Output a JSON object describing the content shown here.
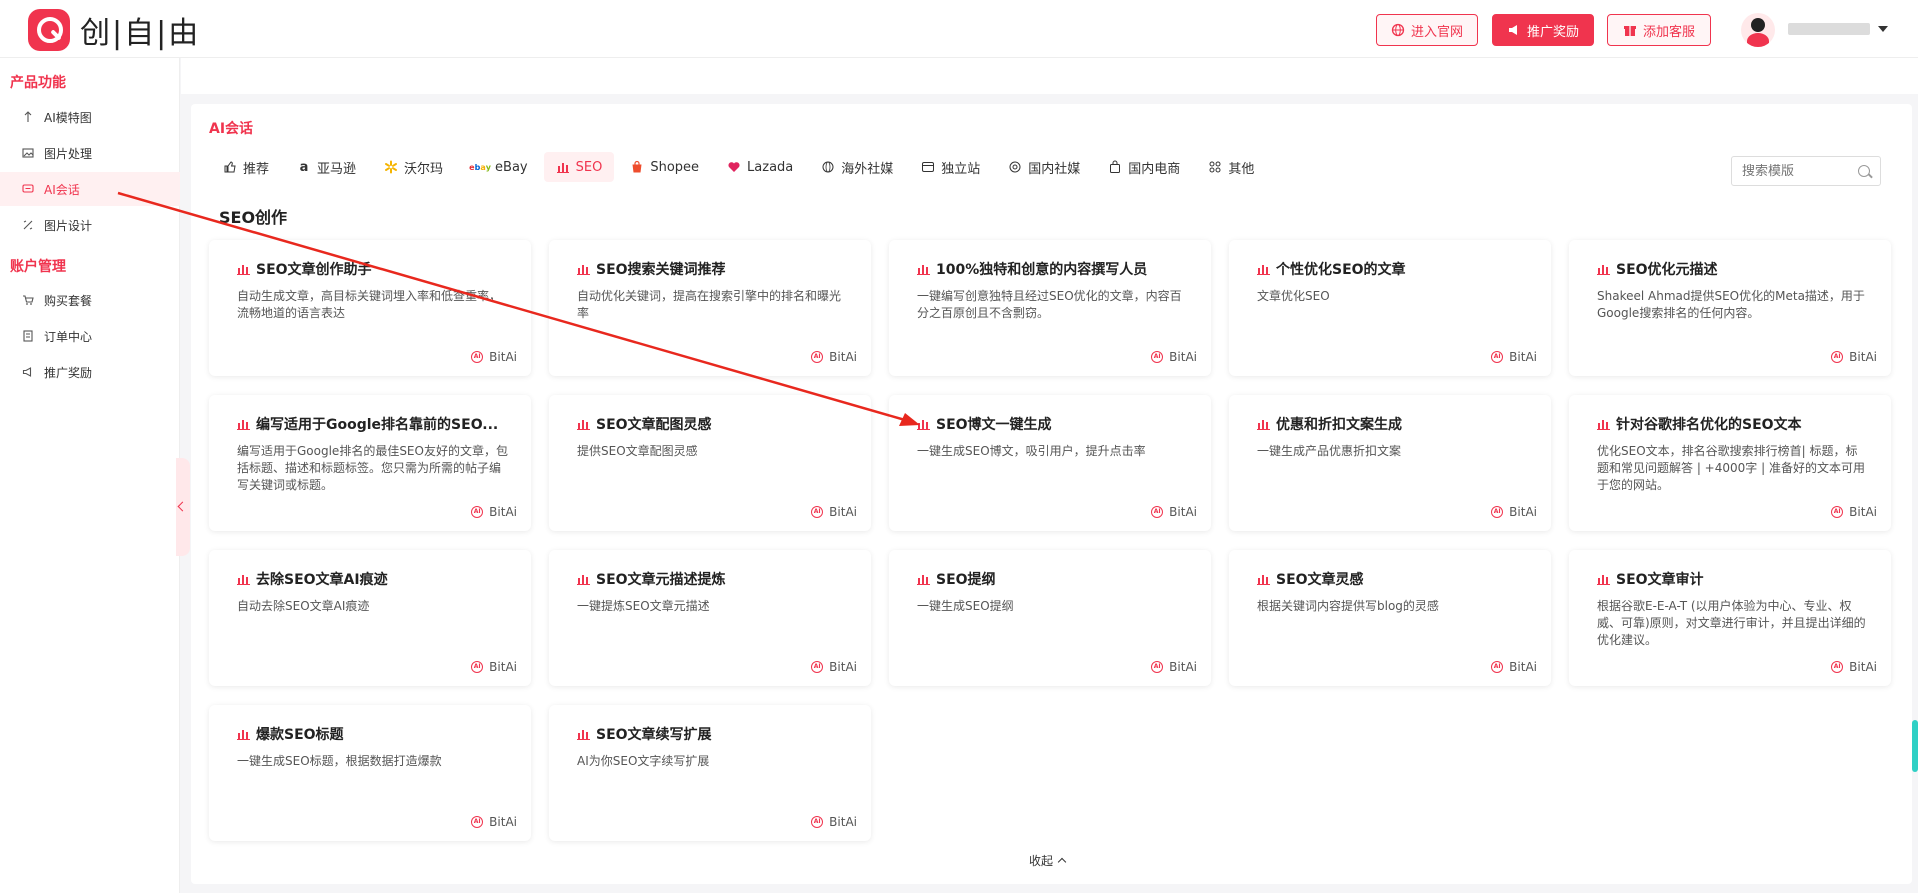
{
  "header": {
    "logo_text": "创|自|由",
    "buttons": [
      {
        "label": "进入官网",
        "icon": "globe-icon"
      },
      {
        "label": "推广奖励",
        "icon": "megaphone-icon"
      },
      {
        "label": "添加客服",
        "icon": "gift-icon"
      }
    ]
  },
  "sidebar": {
    "group1": "产品功能",
    "items1": [
      {
        "label": "AI模特图",
        "icon": "sparkle-icon"
      },
      {
        "label": "图片处理",
        "icon": "image-icon"
      },
      {
        "label": "AI会话",
        "icon": "chat-icon"
      },
      {
        "label": "图片设计",
        "icon": "palette-icon"
      }
    ],
    "group2": "账户管理",
    "items2": [
      {
        "label": "购买套餐",
        "icon": "cart-icon"
      },
      {
        "label": "订单中心",
        "icon": "order-icon"
      },
      {
        "label": "推广奖励",
        "icon": "megaphone-icon"
      }
    ]
  },
  "main": {
    "section_title": "AI会话",
    "tabs": [
      {
        "label": "推荐",
        "icon": "thumbs-up-icon"
      },
      {
        "label": "亚马逊",
        "icon": "amazon-icon"
      },
      {
        "label": "沃尔玛",
        "icon": "walmart-icon"
      },
      {
        "label": "eBay",
        "icon": "ebay-icon"
      },
      {
        "label": "SEO",
        "icon": "bar-chart-icon"
      },
      {
        "label": "Shopee",
        "icon": "shopee-icon"
      },
      {
        "label": "Lazada",
        "icon": "heart-icon"
      },
      {
        "label": "海外社媒",
        "icon": "globe-chat-icon"
      },
      {
        "label": "独立站",
        "icon": "site-icon"
      },
      {
        "label": "国内社媒",
        "icon": "circle-chat-icon"
      },
      {
        "label": "国内电商",
        "icon": "bag-icon"
      },
      {
        "label": "其他",
        "icon": "grid-icon"
      }
    ],
    "search_placeholder": "搜索模版",
    "subsection_title": "SEO创作",
    "brand": "BitAi",
    "cards": [
      {
        "title": "SEO文章创作助手",
        "desc": "自动生成文章，高目标关键词埋入率和低查重率，流畅地道的语言表达"
      },
      {
        "title": "SEO搜索关键词推荐",
        "desc": "自动优化关键词，提高在搜索引擎中的排名和曝光率"
      },
      {
        "title": "100%独特和创意的内容撰写人员",
        "desc": "一键编写创意独特且经过SEO优化的文章，内容百分之百原创且不含剽窃。"
      },
      {
        "title": "个性优化SEO的文章",
        "desc": "文章优化SEO"
      },
      {
        "title": "SEO优化元描述",
        "desc": "Shakeel Ahmad提供SEO优化的Meta描述，用于Google搜索排名的任何内容。"
      },
      {
        "title": "编写适用于Google排名靠前的SEO...",
        "desc": "编写适用于Google排名的最佳SEO友好的文章，包括标题、描述和标题标签。您只需为所需的帖子编写关键词或标题。"
      },
      {
        "title": "SEO文章配图灵感",
        "desc": "提供SEO文章配图灵感"
      },
      {
        "title": "SEO博文一键生成",
        "desc": "一键生成SEO博文，吸引用户，提升点击率"
      },
      {
        "title": "优惠和折扣文案生成",
        "desc": "一键生成产品优惠折扣文案"
      },
      {
        "title": "针对谷歌排名优化的SEO文本",
        "desc": "优化SEO文本，排名谷歌搜索排行榜首| 标题，标题和常见问题解答 | +4000字 | 准备好的文本可用于您的网站。"
      },
      {
        "title": "去除SEO文章AI痕迹",
        "desc": "自动去除SEO文章AI痕迹"
      },
      {
        "title": "SEO文章元描述提炼",
        "desc": "一键提炼SEO文章元描述"
      },
      {
        "title": "SEO提纲",
        "desc": "一键生成SEO提纲"
      },
      {
        "title": "SEO文章灵感",
        "desc": "根据关键词内容提供写blog的灵感"
      },
      {
        "title": "SEO文章审计",
        "desc": "根据谷歌E-E-A-T (以用户体验为中心、专业、权威、可靠)原则，对文章进行审计，并且提出详细的优化建议。"
      },
      {
        "title": "爆款SEO标题",
        "desc": "一键生成SEO标题，根据数据打造爆款"
      },
      {
        "title": "SEO文章续写扩展",
        "desc": "AI为你SEO文字续写扩展"
      }
    ],
    "collapse_label": "收起"
  },
  "colors": {
    "accent": "#f0344e"
  }
}
